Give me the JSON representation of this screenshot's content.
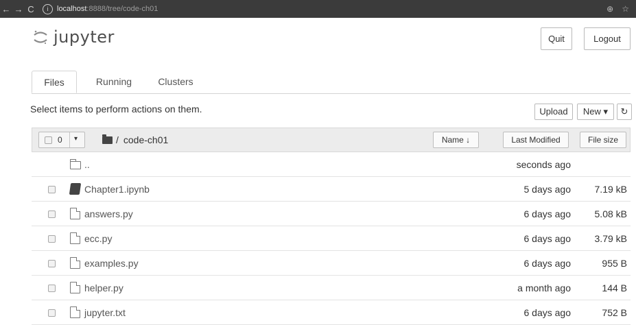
{
  "browser": {
    "url_host": "localhost",
    "url_path": ":8888/tree/code-ch01",
    "back_glyph": "←",
    "forward_glyph": "→",
    "reload_glyph": "C",
    "info_glyph": "i",
    "zoom_glyph": "⊕",
    "star_glyph": "☆"
  },
  "header": {
    "logo_text": "jupyter",
    "quit_label": "Quit",
    "logout_label": "Logout"
  },
  "tabs": [
    {
      "label": "Files",
      "active": true
    },
    {
      "label": "Running",
      "active": false
    },
    {
      "label": "Clusters",
      "active": false
    }
  ],
  "toolbar": {
    "hint": "Select items to perform actions on them.",
    "upload_label": "Upload",
    "new_label": "New ▾",
    "refresh_glyph": "↻"
  },
  "list_header": {
    "selected_count": "0",
    "caret": "▾",
    "breadcrumb_slash": "/",
    "breadcrumb_folder": "code-ch01",
    "name_label": "Name ↓",
    "last_modified_label": "Last Modified",
    "file_size_label": "File size"
  },
  "rows": [
    {
      "type": "folder",
      "name": "..",
      "modified": "seconds ago",
      "size": ""
    },
    {
      "type": "notebook",
      "name": "Chapter1.ipynb",
      "modified": "5 days ago",
      "size": "7.19 kB"
    },
    {
      "type": "file",
      "name": "answers.py",
      "modified": "6 days ago",
      "size": "5.08 kB"
    },
    {
      "type": "file",
      "name": "ecc.py",
      "modified": "6 days ago",
      "size": "3.79 kB"
    },
    {
      "type": "file",
      "name": "examples.py",
      "modified": "6 days ago",
      "size": "955 B"
    },
    {
      "type": "file",
      "name": "helper.py",
      "modified": "a month ago",
      "size": "144 B"
    },
    {
      "type": "file",
      "name": "jupyter.txt",
      "modified": "6 days ago",
      "size": "752 B"
    }
  ],
  "colors": {
    "chrome_bg": "#3b3b3b",
    "list_header_bg": "#ececec",
    "logo_orange": "#f37726"
  }
}
